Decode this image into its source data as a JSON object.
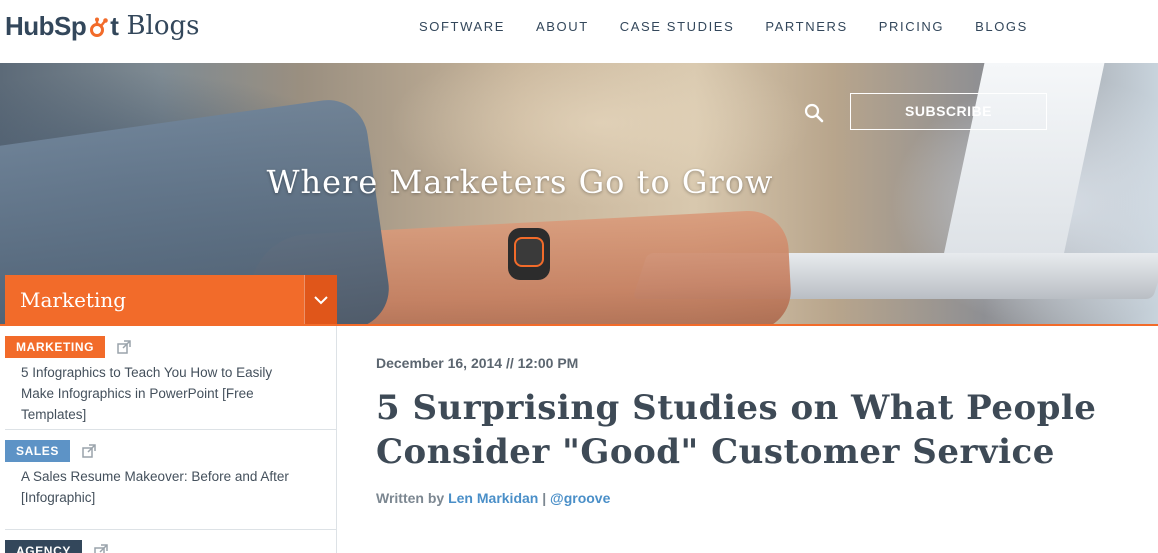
{
  "brand": {
    "logo_hub": "HubSp",
    "logo_t": "t",
    "logo_blogs": "Blogs"
  },
  "nav": {
    "items": [
      "SOFTWARE",
      "ABOUT",
      "CASE STUDIES",
      "PARTNERS",
      "PRICING",
      "BLOGS"
    ]
  },
  "hero": {
    "tagline": "Where Marketers Go to Grow",
    "subscribe_label": "SUBSCRIBE",
    "search_icon": "search-icon"
  },
  "category": {
    "selected": "Marketing",
    "chevron_icon": "chevron-down-icon"
  },
  "sidebar": {
    "items": [
      {
        "tag": "MARKETING",
        "tag_color": "#f26b2a",
        "title": "5 Infographics to Teach You How to Easily Make Infographics in PowerPoint [Free Templates]"
      },
      {
        "tag": "SALES",
        "tag_color": "#5d93c6",
        "title": "A Sales Resume Makeover: Before and After [Infographic]"
      },
      {
        "tag": "AGENCY",
        "tag_color": "#33475b",
        "title": ""
      }
    ]
  },
  "article": {
    "date": "December 16, 2014 // 12:00 PM",
    "title": "5 Surprising Studies on What People Consider \"Good\" Customer Service",
    "byline_prefix": "Written by",
    "author": "Len Markidan",
    "separator": "|",
    "handle": "@groove"
  },
  "colors": {
    "accent": "#f26b2a",
    "text_dark": "#33475b",
    "link": "#4a8fc8"
  }
}
